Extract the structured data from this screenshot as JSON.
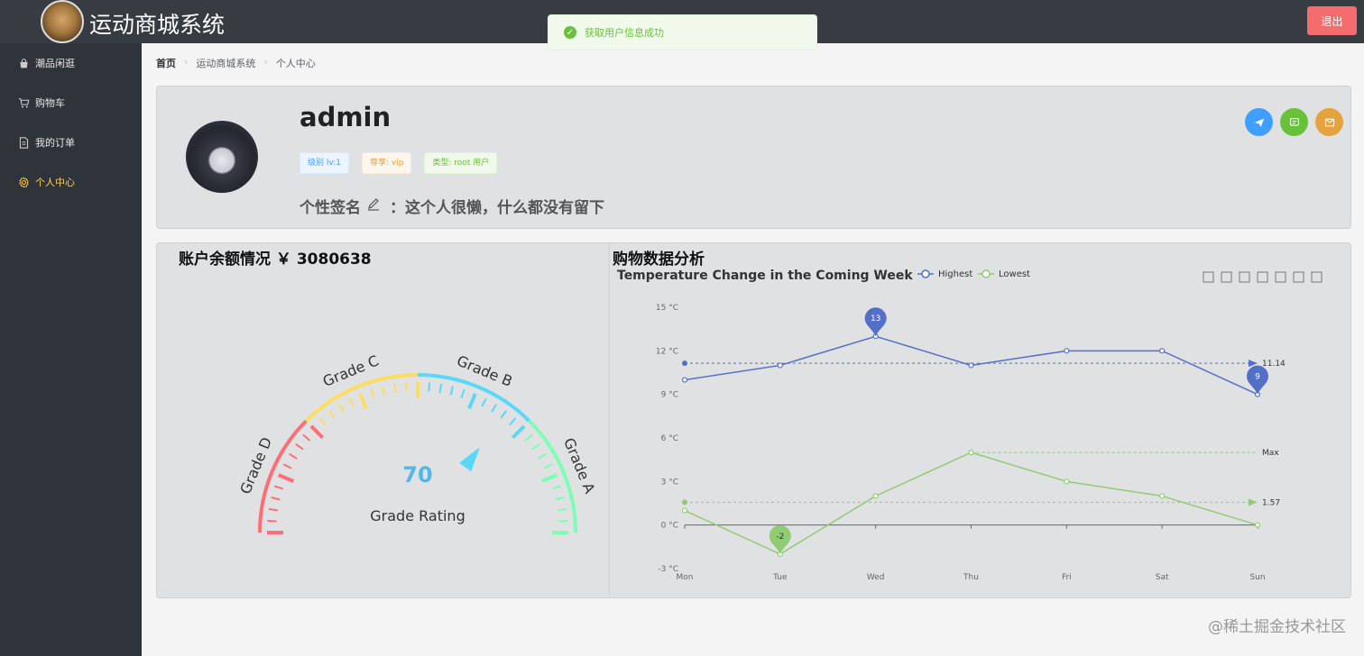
{
  "header": {
    "title": "运动商城系统",
    "logout_label": "退出"
  },
  "toast": {
    "message": "获取用户信息成功"
  },
  "sidebar": {
    "items": [
      {
        "label": "潮品闲逛",
        "icon": "bag-icon"
      },
      {
        "label": "购物车",
        "icon": "cart-icon"
      },
      {
        "label": "我的订单",
        "icon": "document-icon"
      },
      {
        "label": "个人中心",
        "icon": "gear-icon",
        "active": true
      }
    ]
  },
  "breadcrumb": [
    "首页",
    "运动商城系统",
    "个人中心"
  ],
  "profile": {
    "username": "admin",
    "tags": [
      "级别 lv:1",
      "尊享: vip",
      "类型: root 用户"
    ],
    "signature_label": "个性签名",
    "signature_sep": "：",
    "signature_text": "这个人很懒，什么都没有留下",
    "actions": [
      "send-icon",
      "message-icon",
      "mail-icon"
    ]
  },
  "balance": {
    "title": "账户余额情况 ￥ 3080638"
  },
  "gauge": {
    "value": 70,
    "label": "Grade Rating",
    "grades": [
      "Grade D",
      "Grade C",
      "Grade B",
      "Grade A"
    ],
    "colors": [
      "#ff6e76",
      "#fddd60",
      "#58d9f9",
      "#7cffb2"
    ]
  },
  "analysis": {
    "title": "购物数据分析"
  },
  "chart_data": {
    "type": "line",
    "title": "Temperature Change in the Coming Week",
    "categories": [
      "Mon",
      "Tue",
      "Wed",
      "Thu",
      "Fri",
      "Sat",
      "Sun"
    ],
    "ylim": [
      -3,
      15
    ],
    "yticks": [
      "15 °C",
      "12 °C",
      "9 °C",
      "6 °C",
      "3 °C",
      "0 °C",
      "-3 °C"
    ],
    "series": [
      {
        "name": "Highest",
        "values": [
          10,
          11,
          13,
          11,
          12,
          12,
          9
        ],
        "color": "#5470c6",
        "markpoints": [
          {
            "label": "13",
            "index": 2
          },
          {
            "label": "9",
            "index": 6
          }
        ],
        "avg_label": "11.14"
      },
      {
        "name": "Lowest",
        "values": [
          1,
          -2,
          2,
          5,
          3,
          2,
          0
        ],
        "color": "#91cc75",
        "markpoints": [
          {
            "label": "-2",
            "index": 1
          }
        ],
        "avg_label": "1.57",
        "max_label": "Max"
      }
    ],
    "legend": "top",
    "toolbox": [
      "zoom-icon",
      "zoom-reset-icon",
      "data-view-icon",
      "line-icon",
      "bar-icon",
      "restore-icon",
      "download-icon"
    ]
  },
  "watermark": "@稀土掘金技术社区"
}
